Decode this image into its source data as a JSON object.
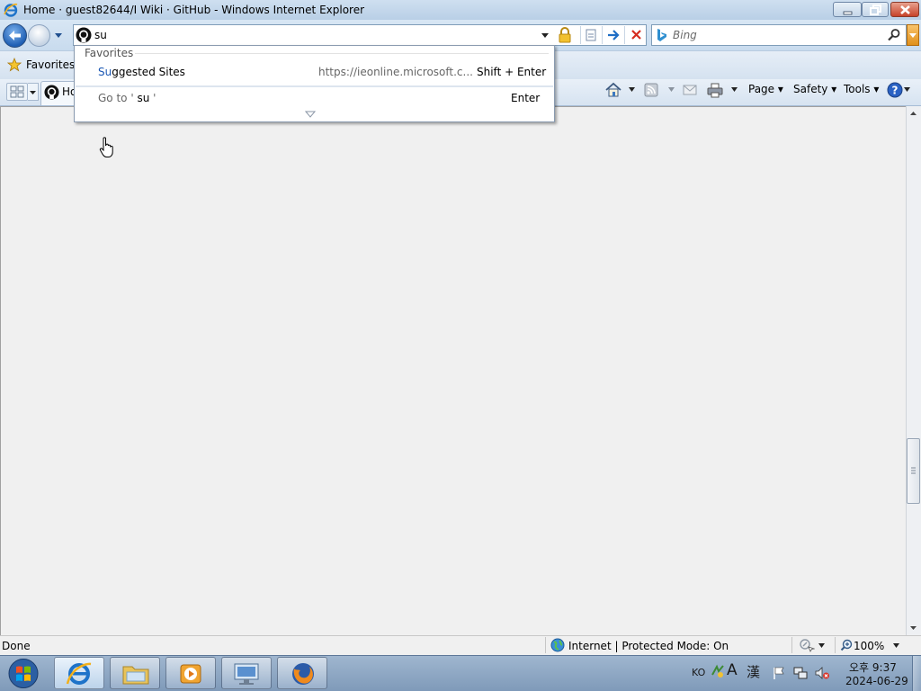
{
  "window": {
    "title": "Home · guest82644/I Wiki · GitHub - Windows Internet Explorer"
  },
  "address_bar": {
    "value": "su",
    "favicon": "github-icon"
  },
  "search": {
    "placeholder": "Bing",
    "provider_icon": "bing-icon"
  },
  "favorites_bar": {
    "favorites_label": "Favorites"
  },
  "tab": {
    "title": "Ho",
    "favicon": "github-icon"
  },
  "command_bar": {
    "page_label": "Page",
    "safety_label": "Safety",
    "tools_label": "Tools"
  },
  "autocomplete": {
    "section_header": "Favorites",
    "suggested": {
      "title_highlight": "Su",
      "title_rest": "ggested Sites",
      "url": "https://ieonline.microsoft.c...",
      "shortcut": "Shift + Enter"
    },
    "goto": {
      "prefix": "Go to '",
      "query": " su ",
      "suffix": "'",
      "shortcut": "Enter"
    }
  },
  "status_bar": {
    "status": "Done",
    "zone": "Internet | Protected Mode: On",
    "zoom": "100%"
  },
  "taskbar": {
    "apps": [
      "internet-explorer",
      "windows-explorer",
      "media-player",
      "network-app",
      "firefox"
    ],
    "tray": {
      "language": "KO",
      "a_glyph": "A",
      "hanja_glyph": "漢"
    },
    "clock": {
      "time": "오후 9:37",
      "date": "2024-06-29"
    }
  },
  "colors": {
    "accent_blue": "#1f5fb4",
    "highlight_blue": "#1a57b4",
    "search_orange": "#e0901b",
    "close_red": "#c7432a"
  }
}
